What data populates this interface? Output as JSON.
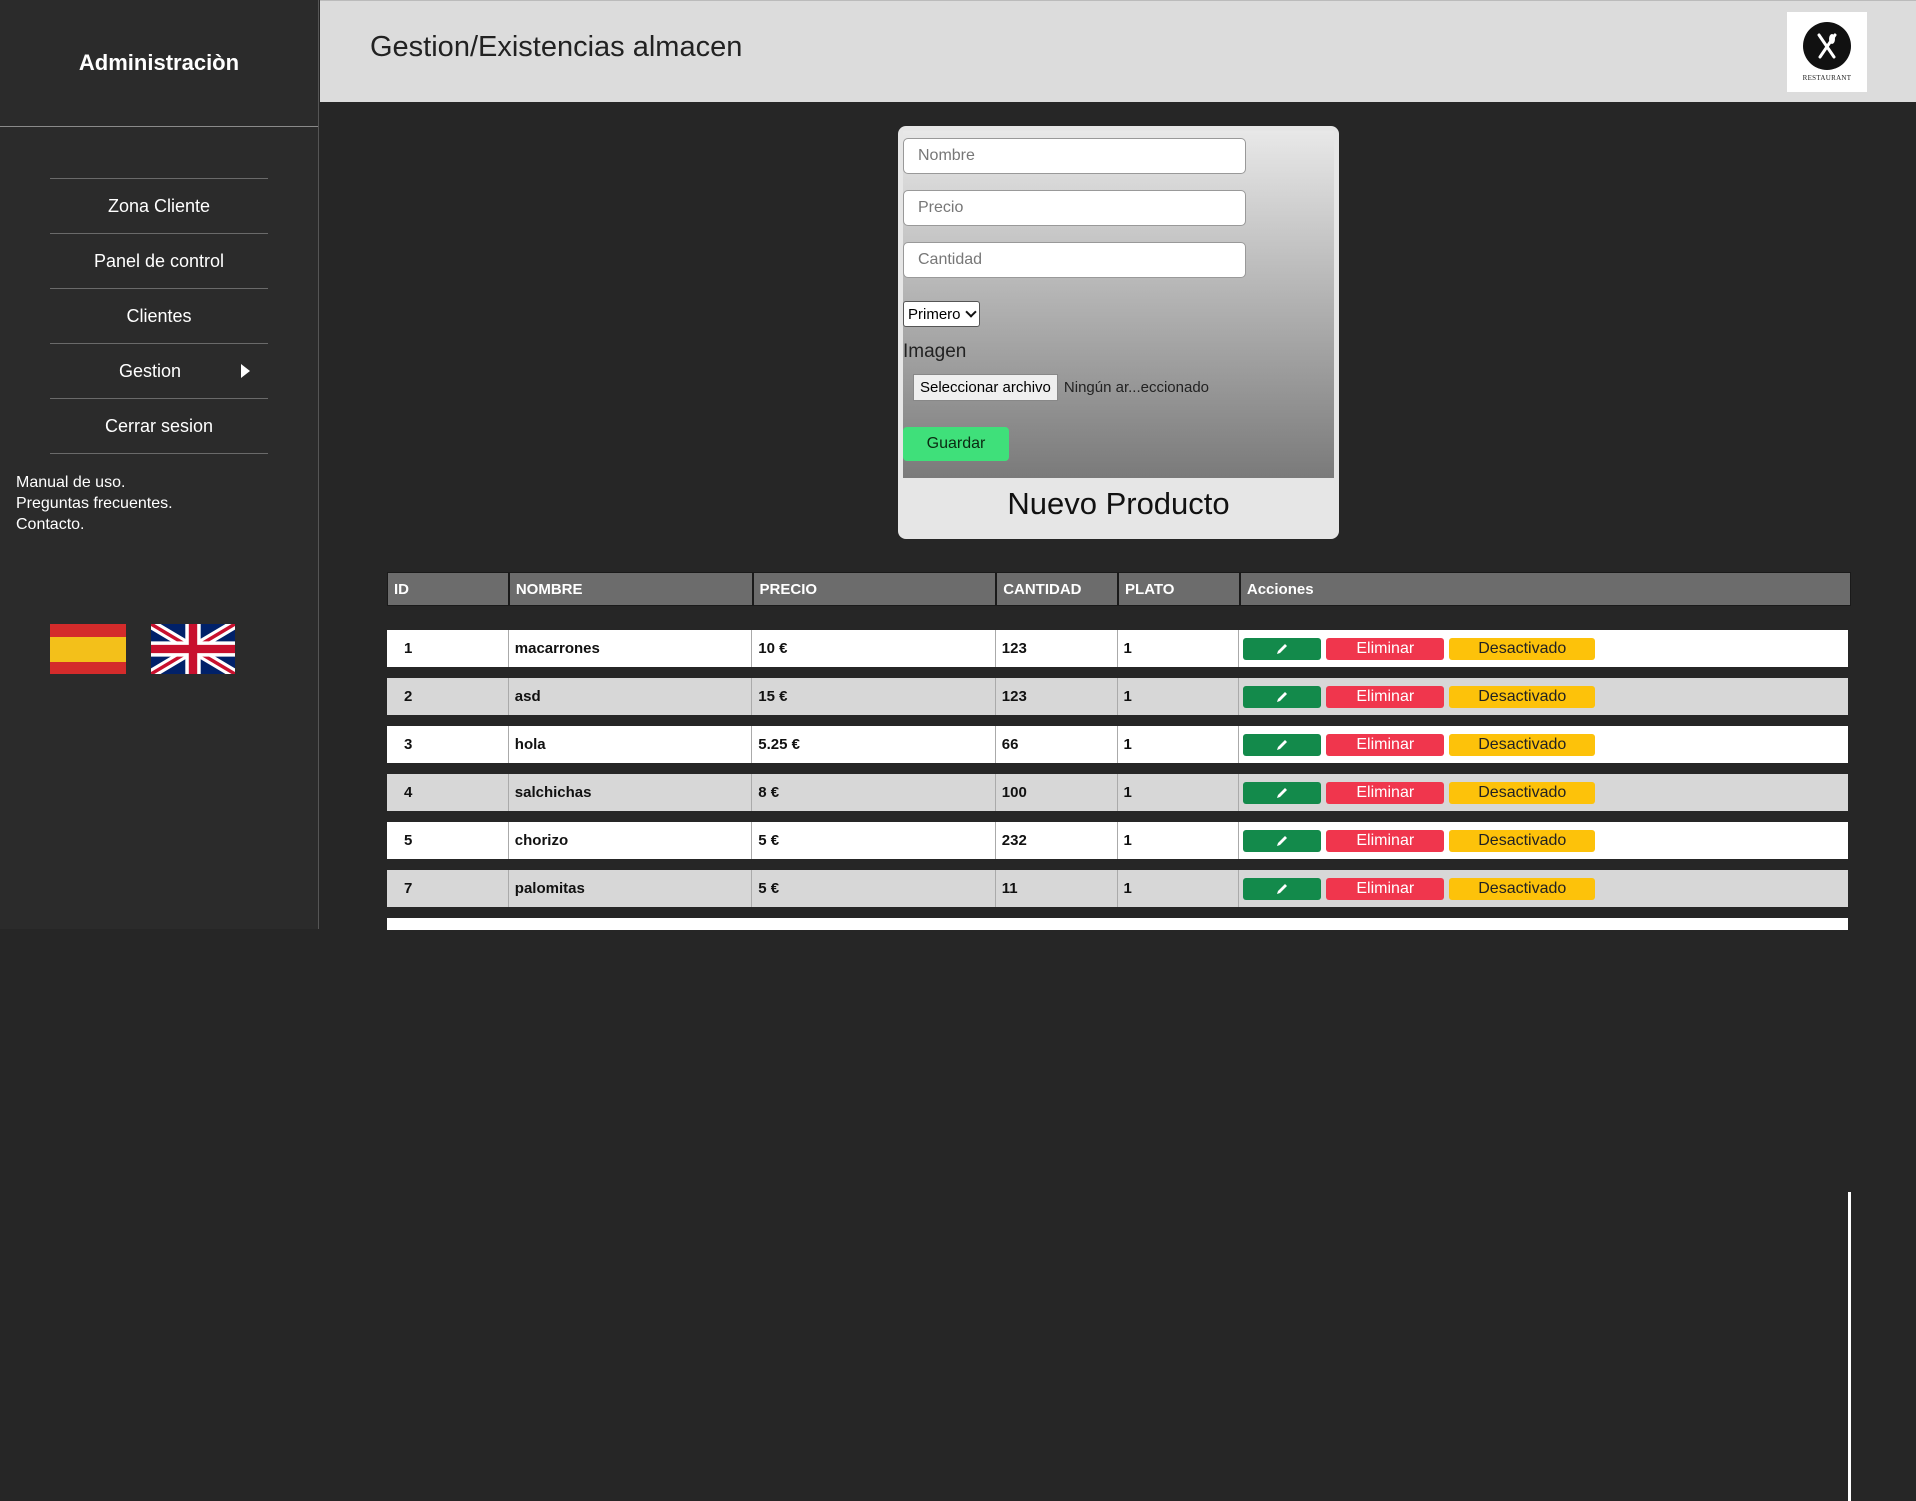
{
  "sidebar": {
    "title": "Administraciòn",
    "nav": [
      {
        "label": "Zona Cliente"
      },
      {
        "label": "Panel de control"
      },
      {
        "label": "Clientes"
      },
      {
        "label": "Gestion"
      },
      {
        "label": "Cerrar sesion"
      }
    ],
    "links": [
      "Manual de uso.",
      "Preguntas frecuentes.",
      "Contacto."
    ],
    "flags": [
      "spain-flag-icon",
      "uk-flag-icon"
    ]
  },
  "header": {
    "title": "Gestion/Existencias almacen",
    "logo_text": "RESTAURANT"
  },
  "form": {
    "nombre_placeholder": "Nombre",
    "precio_placeholder": "Precio",
    "cantidad_placeholder": "Cantidad",
    "plato_selected": "Primero",
    "imagen_label": "Imagen",
    "file_button": "Seleccionar archivo",
    "file_status": "Ningún ar...eccionado",
    "save_label": "Guardar",
    "title": "Nuevo Producto"
  },
  "table": {
    "headers": [
      "ID",
      "NOMBRE",
      "PRECIO",
      "CANTIDAD",
      "PLATO",
      "Acciones"
    ],
    "rows": [
      {
        "id": "1",
        "nombre": "macarrones",
        "precio": "10 €",
        "cantidad": "123",
        "plato": "1"
      },
      {
        "id": "2",
        "nombre": "asd",
        "precio": "15 €",
        "cantidad": "123",
        "plato": "1"
      },
      {
        "id": "3",
        "nombre": "hola",
        "precio": "5.25 €",
        "cantidad": "66",
        "plato": "1"
      },
      {
        "id": "4",
        "nombre": "salchichas",
        "precio": "8 €",
        "cantidad": "100",
        "plato": "1"
      },
      {
        "id": "5",
        "nombre": "chorizo",
        "precio": "5 €",
        "cantidad": "232",
        "plato": "1"
      },
      {
        "id": "7",
        "nombre": "palomitas",
        "precio": "5 €",
        "cantidad": "11",
        "plato": "1"
      }
    ],
    "delete_label": "Eliminar",
    "deactivated_label": "Desactivado"
  },
  "colors": {
    "save": "#3fe07a",
    "edit": "#138a4b",
    "delete": "#f0364d",
    "deactivated": "#fdc20a"
  }
}
